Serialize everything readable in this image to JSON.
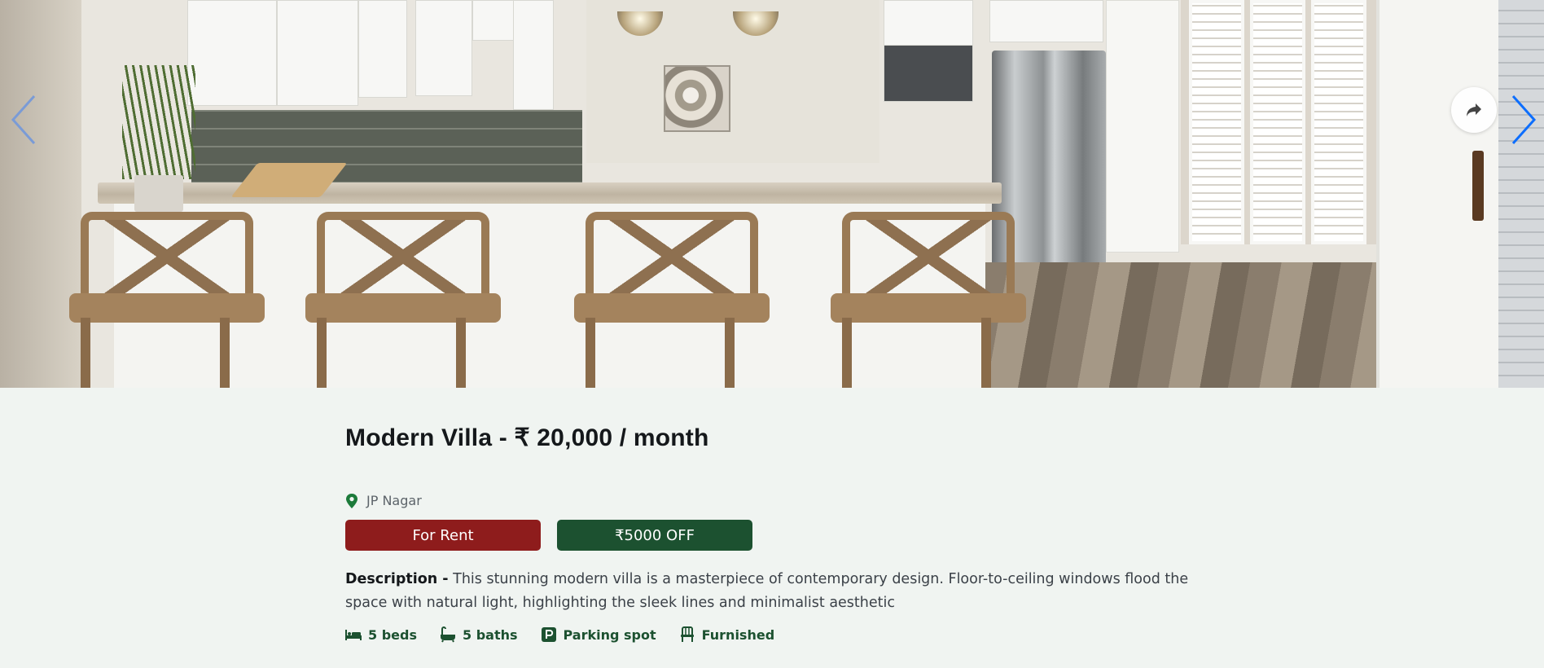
{
  "carousel": {
    "image_alt": "Modern kitchen with island and wooden bar stools",
    "prev_color": "#7a9bd6",
    "next_color": "#0d6efd"
  },
  "listing": {
    "title": "Modern Villa - ₹ 20,000 / month",
    "location": "JP Nagar",
    "location_icon_color": "#1c7a3a",
    "badges": {
      "status": "For Rent",
      "status_color": "#8e1c1c",
      "offer": "₹5000 OFF",
      "offer_color": "#1c5130"
    },
    "description_label": "Description -",
    "description": "This stunning modern villa is a masterpiece of contemporary design. Floor-to-ceiling windows flood the space with natural light, highlighting the sleek lines and minimalist aesthetic",
    "features": [
      {
        "icon": "bed-icon",
        "label": "5 beds"
      },
      {
        "icon": "bath-icon",
        "label": "5 baths"
      },
      {
        "icon": "parking-icon",
        "label": "Parking spot"
      },
      {
        "icon": "chair-icon",
        "label": "Furnished"
      }
    ],
    "feature_color": "#1c5130"
  }
}
